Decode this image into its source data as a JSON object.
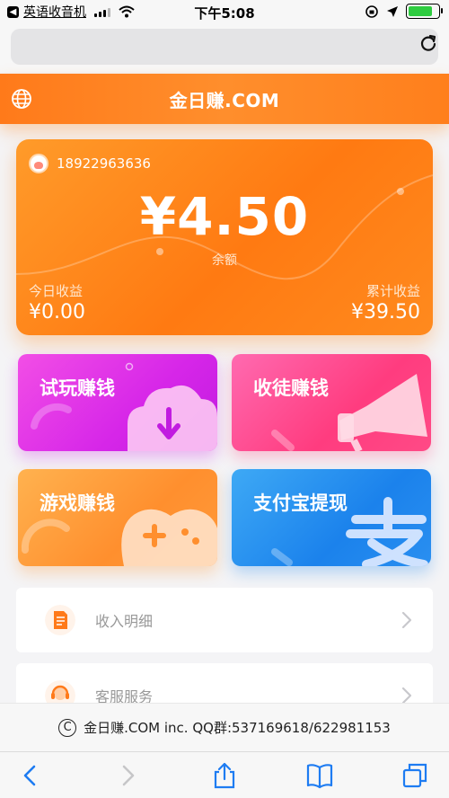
{
  "status_bar": {
    "back_app": "英语收音机",
    "time": "下午5:08",
    "battery_level": 0.8
  },
  "browser": {
    "url": ""
  },
  "header": {
    "title": "金日赚.COM"
  },
  "balance_card": {
    "phone": "18922963636",
    "balance": "¥4.50",
    "balance_label": "余额",
    "today_label": "今日收益",
    "today_value": "¥0.00",
    "total_label": "累计收益",
    "total_value": "¥39.50"
  },
  "tiles": [
    {
      "label": "试玩赚钱",
      "color": "#d626e8",
      "icon": "cloud-download-icon"
    },
    {
      "label": "收徒赚钱",
      "color": "#ff3c7f",
      "icon": "megaphone-icon"
    },
    {
      "label": "游戏赚钱",
      "color": "#ff8f2e",
      "icon": "gamepad-icon"
    },
    {
      "label": "支付宝提现",
      "color": "#1b82ec",
      "icon": "alipay-icon"
    }
  ],
  "list": [
    {
      "label": "收入明细",
      "icon": "document-icon"
    },
    {
      "label": "客服服务",
      "icon": "headset-icon"
    }
  ],
  "footer": {
    "copyright_symbol": "C",
    "text": "金日赚.COM inc. QQ群:537169618/622981153"
  },
  "colors": {
    "accent": "#ff7f1c",
    "background": "#f4f4f6"
  }
}
